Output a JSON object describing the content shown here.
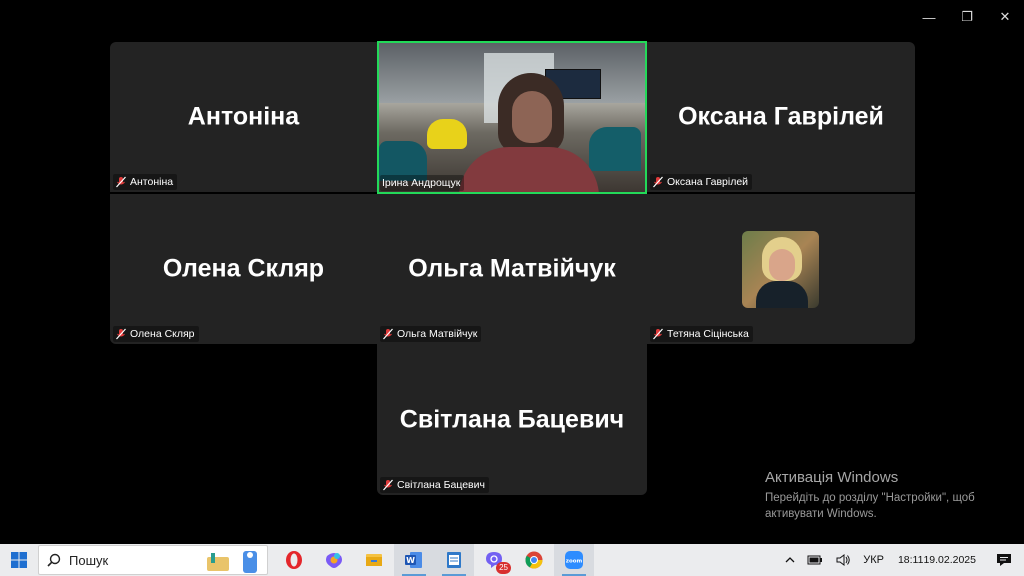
{
  "window_controls": {
    "minimize": "—",
    "restore": "❐",
    "close": "✕"
  },
  "participants": [
    {
      "id": "r1c1",
      "display_name": "Антоніна",
      "label": "Антоніна",
      "muted": true,
      "video": false
    },
    {
      "id": "r1c2",
      "display_name": "",
      "label": "Ірина  Андрощук",
      "muted": false,
      "video": true,
      "active_speaker": true
    },
    {
      "id": "r1c3",
      "display_name": "Оксана Гаврілей",
      "label": "Оксана Гаврілей",
      "muted": true,
      "video": false
    },
    {
      "id": "r2c1",
      "display_name": "Олена Скляр",
      "label": "Олена Скляр",
      "muted": true,
      "video": false
    },
    {
      "id": "r2c2",
      "display_name": "Ольга Матвійчук",
      "label": "Ольга Матвійчук",
      "muted": true,
      "video": false
    },
    {
      "id": "r2c3",
      "display_name": "",
      "label": "Тетяна Сіцінська",
      "muted": true,
      "video": false,
      "avatar": true
    },
    {
      "id": "r3c2",
      "display_name": "Світлана Бацевич",
      "label": "Світлана Бацевич",
      "muted": true,
      "video": false
    }
  ],
  "activation": {
    "title": "Активація Windows",
    "line1": "Перейдіть до розділу \"Настройки\", щоб",
    "line2": "активувати Windows."
  },
  "taskbar": {
    "search_placeholder": "Пошук",
    "apps": [
      "opera-icon",
      "copilot-icon",
      "file-explorer-icon",
      "word-icon",
      "notepad-icon",
      "viber-icon",
      "chrome-icon",
      "zoom-icon"
    ],
    "viber_badge": "25",
    "language": "УКР",
    "time": "18:11",
    "date": "19.02.2025"
  },
  "colors": {
    "active_speaker_border": "#23d959",
    "tile_bg": "#232323",
    "muted_icon": "#e03a3a"
  }
}
